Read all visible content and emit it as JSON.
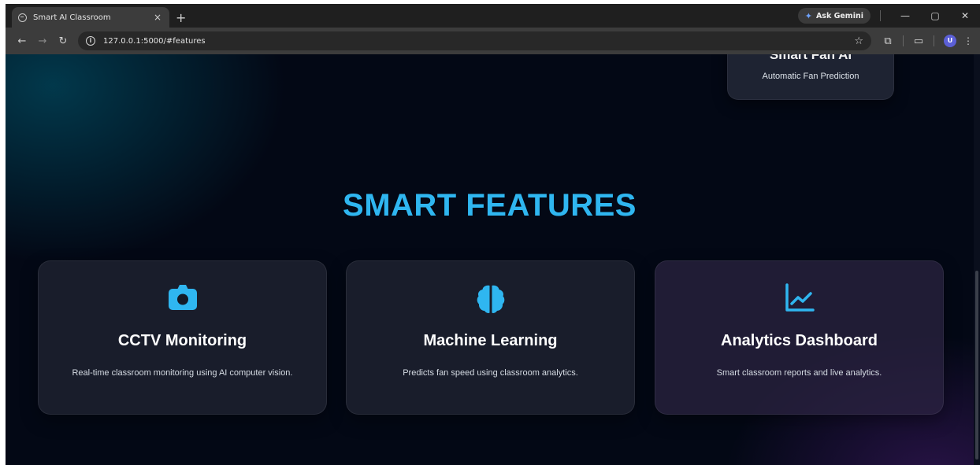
{
  "browser": {
    "tab_title": "Smart AI Classroom",
    "tab_close": "×",
    "new_tab": "+",
    "gemini_label": "Ask Gemini",
    "url": "127.0.0.1:5000/#features",
    "profile_initial": "U",
    "window_controls": [
      "—",
      "▢",
      "✕"
    ]
  },
  "page": {
    "partial_card": {
      "title": "Smart Fan AI",
      "subtitle": "Automatic Fan Prediction"
    },
    "section_title": "SMART FEATURES",
    "features": [
      {
        "icon": "camera-icon",
        "title": "CCTV Monitoring",
        "description": "Real-time classroom monitoring using AI computer vision."
      },
      {
        "icon": "brain-icon",
        "title": "Machine Learning",
        "description": "Predicts fan speed using classroom analytics."
      },
      {
        "icon": "chart-line-icon",
        "title": "Analytics Dashboard",
        "description": "Smart classroom reports and live analytics."
      }
    ]
  },
  "colors": {
    "accent": "#2fb6f0",
    "background": "#030815"
  }
}
